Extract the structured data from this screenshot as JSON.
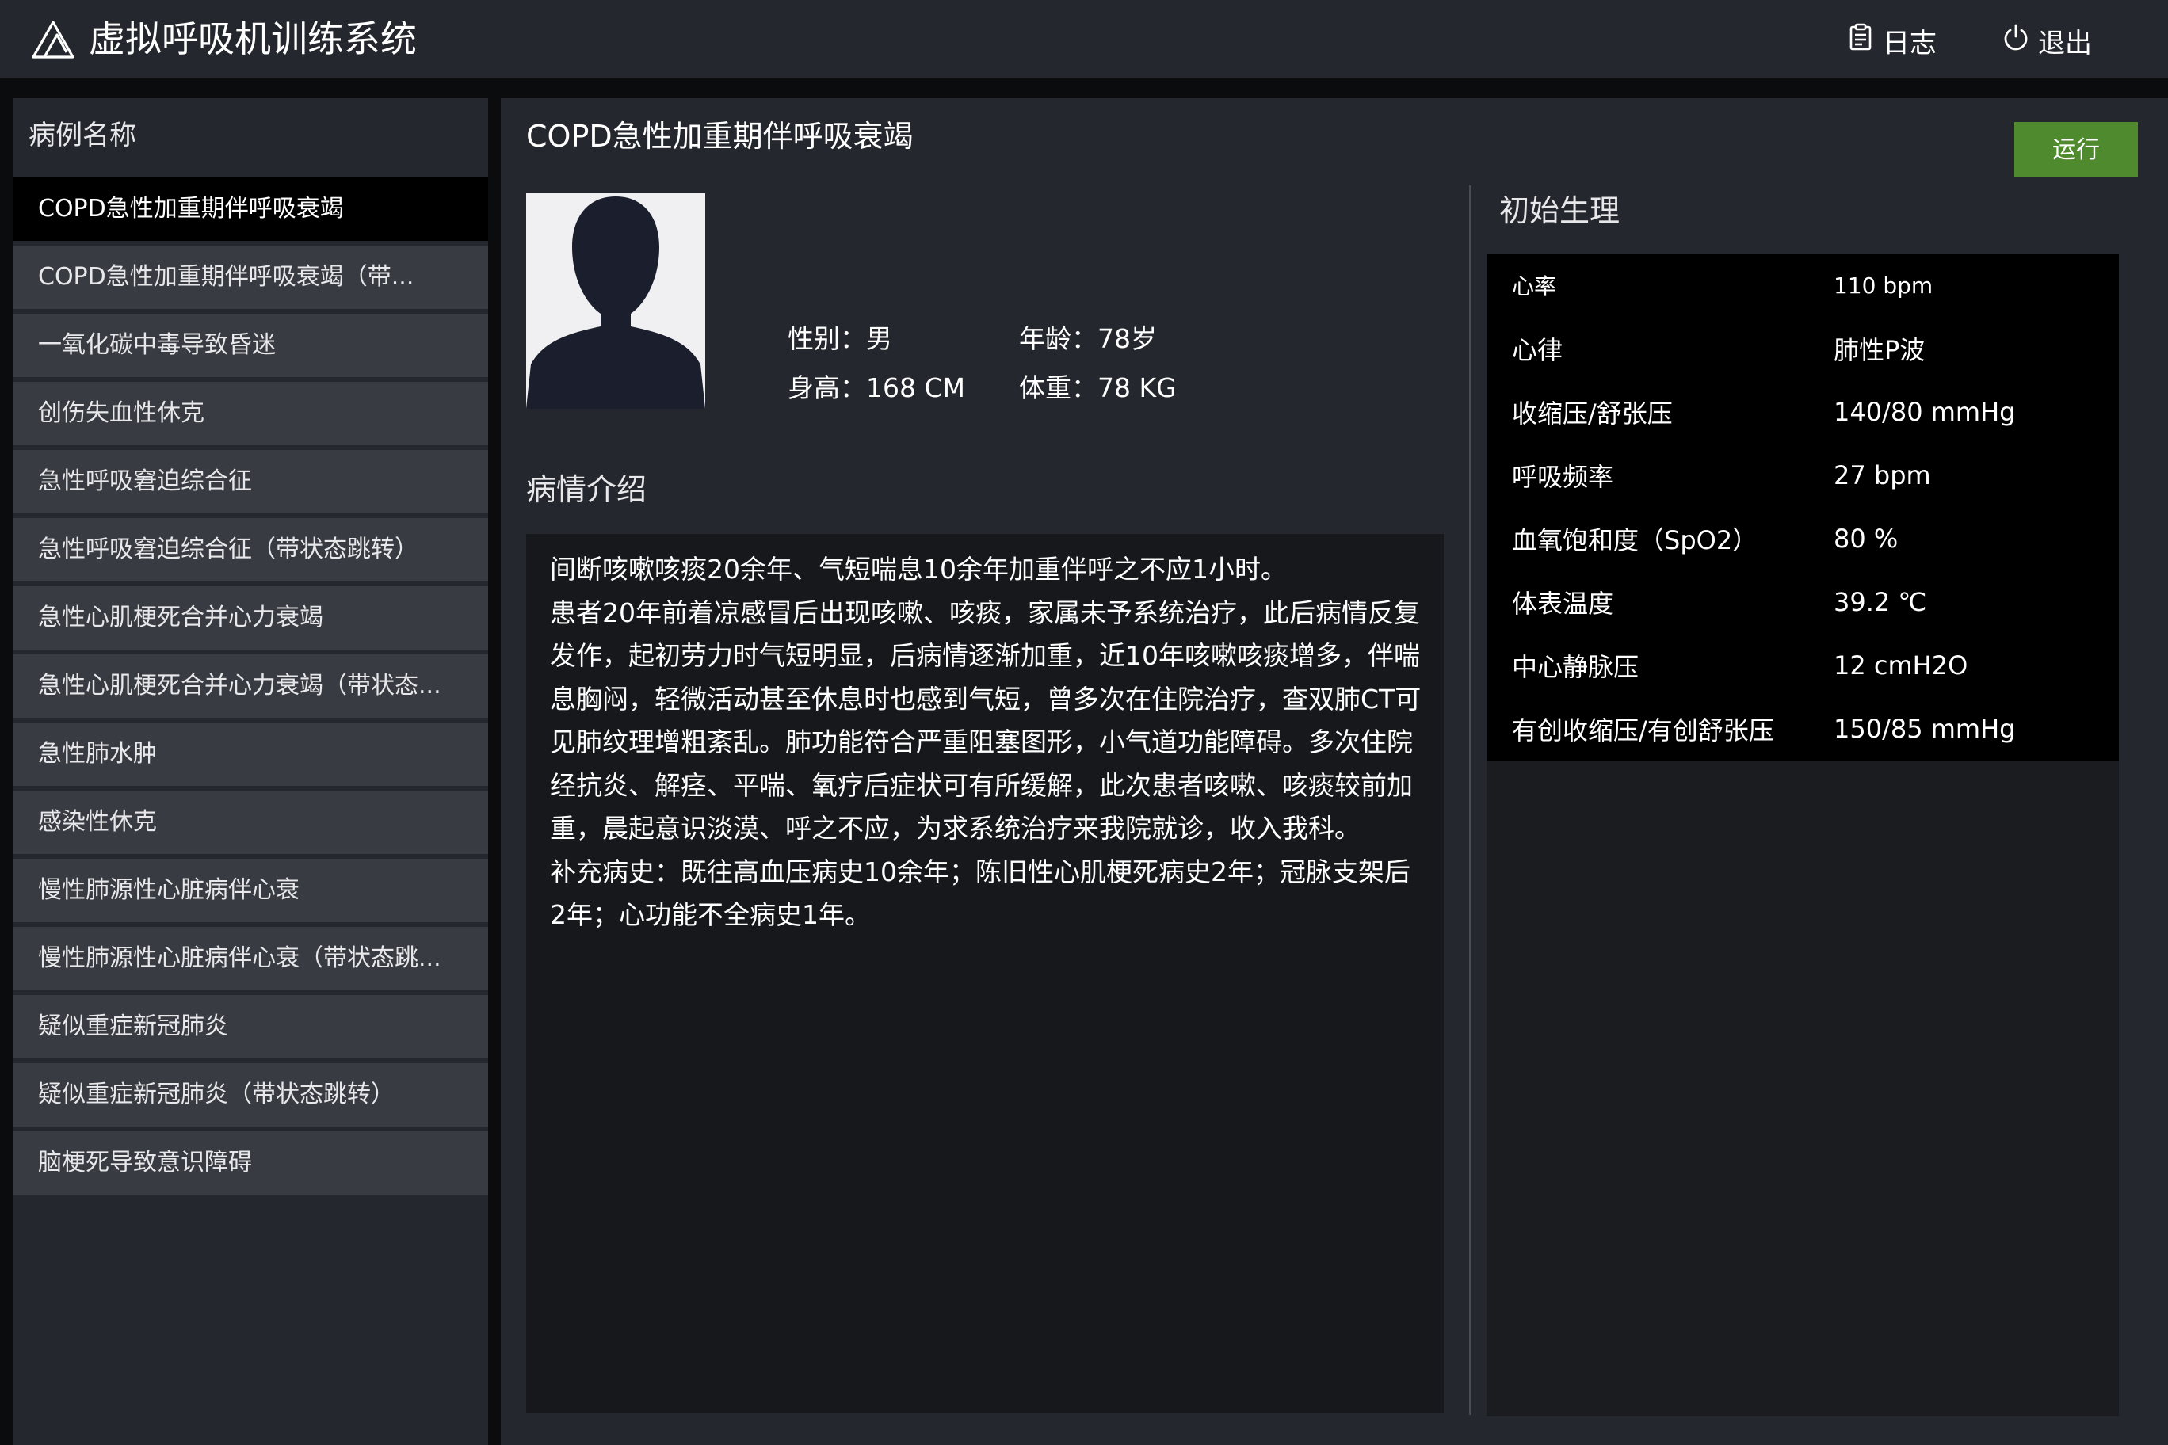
{
  "header": {
    "app_title": "虚拟呼吸机训练系统",
    "log_label": "日志",
    "exit_label": "退出"
  },
  "sidebar": {
    "heading": "病例名称",
    "items": [
      "COPD急性加重期伴呼吸衰竭",
      "COPD急性加重期伴呼吸衰竭（带...",
      "一氧化碳中毒导致昏迷",
      "创伤失血性休克",
      "急性呼吸窘迫综合征",
      "急性呼吸窘迫综合征（带状态跳转）",
      "急性心肌梗死合并心力衰竭",
      "急性心肌梗死合并心力衰竭（带状态...",
      "急性肺水肿",
      "感染性休克",
      "慢性肺源性心脏病伴心衰",
      "慢性肺源性心脏病伴心衰（带状态跳...",
      "疑似重症新冠肺炎",
      "疑似重症新冠肺炎（带状态跳转）",
      "脑梗死导致意识障碍"
    ],
    "selected_index": 0
  },
  "main": {
    "case_title": "COPD急性加重期伴呼吸衰竭",
    "run_label": "运行",
    "patient": {
      "sex_label": "性别：",
      "sex": "男",
      "age_label": "年龄：",
      "age": "78岁",
      "height_label": "身高：",
      "height": "168 CM",
      "weight_label": "体重：",
      "weight": "78 KG"
    },
    "description_heading": "病情介绍",
    "description": "间断咳嗽咳痰20余年、气短喘息10余年加重伴呼之不应1小时。\n患者20年前着凉感冒后出现咳嗽、咳痰，家属未予系统治疗，此后病情反复发作，起初劳力时气短明显，后病情逐渐加重，近10年咳嗽咳痰增多，伴喘息胸闷，轻微活动甚至休息时也感到气短，曾多次在住院治疗，查双肺CT可见肺纹理增粗紊乱。肺功能符合严重阻塞图形，小气道功能障碍。多次住院经抗炎、解痉、平喘、氧疗后症状可有所缓解，此次患者咳嗽、咳痰较前加重，晨起意识淡漠、呼之不应，为求系统治疗来我院就诊，收入我科。\n补充病史：既往高血压病史10余年；陈旧性心肌梗死病史2年；冠脉支架后2年；心功能不全病史1年。",
    "physiology_heading": "初始生理",
    "physiology": [
      {
        "label": "心率",
        "value": "110 bpm"
      },
      {
        "label": "心律",
        "value": "肺性P波"
      },
      {
        "label": "收缩压/舒张压",
        "value": "140/80 mmHg"
      },
      {
        "label": "呼吸频率",
        "value": "27 bpm"
      },
      {
        "label": "血氧饱和度（SpO2）",
        "value": "80 %"
      },
      {
        "label": "体表温度",
        "value": "39.2 ℃"
      },
      {
        "label": "中心静脉压",
        "value": "12 cmH2O"
      },
      {
        "label": "有创收缩压/有创舒张压",
        "value": "150/85 mmHg"
      }
    ]
  },
  "colors": {
    "page_bg": "#0b0c0e",
    "panel_bg": "#24272d",
    "list_item_bg": "#383b42",
    "selected_bg": "#000000",
    "accent_run": "#4f8a2e",
    "text": "#ffffff"
  },
  "icons": {
    "logo": "mountain-logo-icon",
    "log": "clipboard-icon",
    "exit": "power-icon",
    "avatar": "person-silhouette-icon"
  }
}
